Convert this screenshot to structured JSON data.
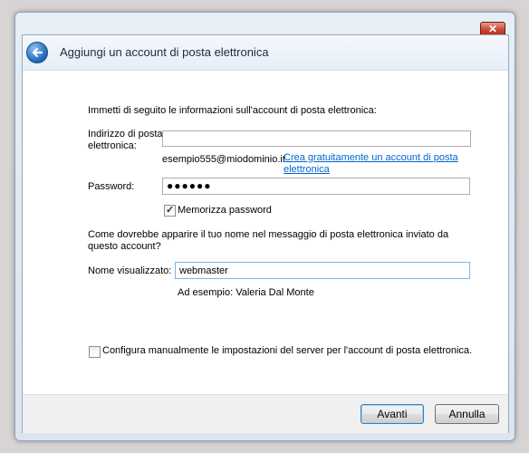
{
  "window": {
    "title": "Aggiungi un account di posta elettronica",
    "close_glyph": "✕"
  },
  "form": {
    "intro": "Immetti di seguito le informazioni sull'account di posta elettronica:",
    "email_label": "Indirizzo di posta elettronica:",
    "email_value": "",
    "email_example": "esempio555@miodominio.it",
    "create_link": "Crea gratuitamente un account di posta elettronica",
    "password_label": "Password:",
    "password_value": "●●●●●●",
    "remember_label": "Memorizza password",
    "remember_checked": true,
    "name_question": "Come dovrebbe apparire il tuo nome nel messaggio di posta elettronica inviato da questo account?",
    "display_name_label": "Nome visualizzato:",
    "display_name_value": "webmaster",
    "display_name_example": "Ad esempio: Valeria Dal Monte",
    "manual_config_label": "Configura manualmente le impostazioni del server per l'account di posta elettronica.",
    "manual_config_checked": false
  },
  "buttons": {
    "next": "Avanti",
    "cancel": "Annulla"
  },
  "icons": {
    "back": "back-arrow-icon",
    "close": "close-icon",
    "check": "checkmark-icon"
  }
}
